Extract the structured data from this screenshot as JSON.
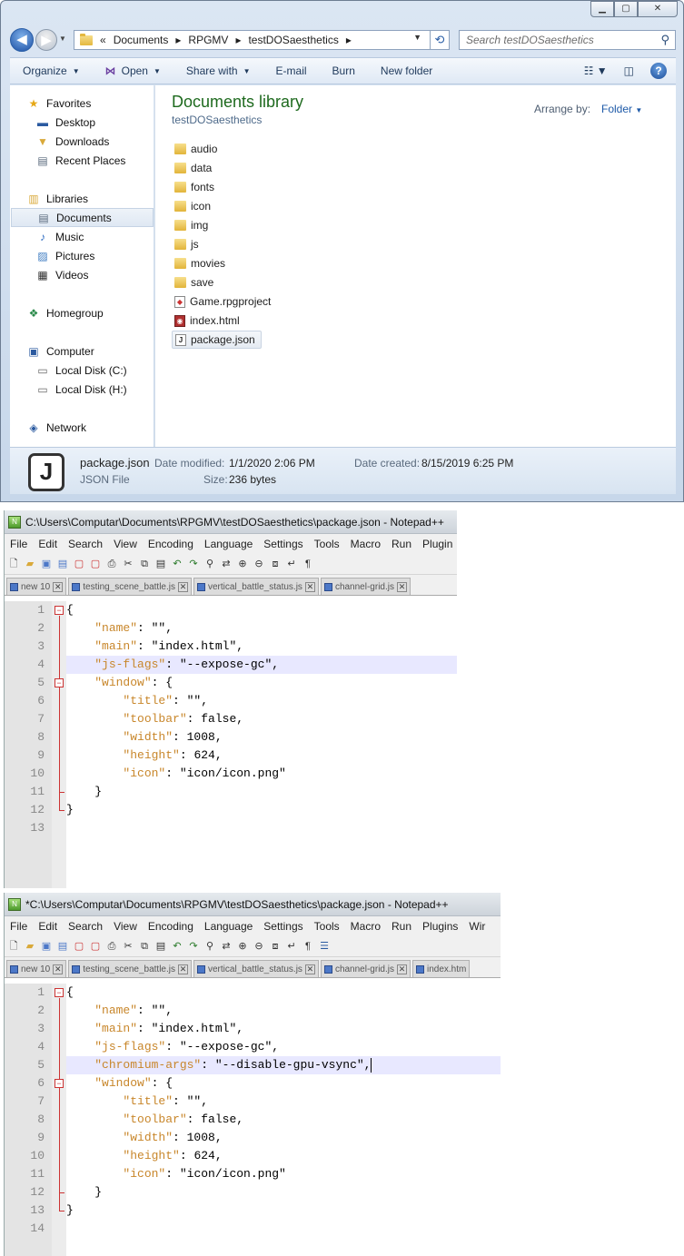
{
  "explorer": {
    "window_controls": {
      "minimize": "▁",
      "maximize": "▢",
      "close": "✕"
    },
    "breadcrumb": {
      "prefix": "«",
      "items": [
        "Documents",
        "RPGMV",
        "testDOSaesthetics"
      ],
      "sep": "▸"
    },
    "search_placeholder": "Search testDOSaesthetics",
    "toolbar": {
      "organize": "Organize",
      "open": "Open",
      "share_with": "Share with",
      "email": "E-mail",
      "burn": "Burn",
      "new_folder": "New folder"
    },
    "sidebar": {
      "favorites": "Favorites",
      "desktop": "Desktop",
      "downloads": "Downloads",
      "recent_places": "Recent Places",
      "libraries": "Libraries",
      "documents": "Documents",
      "music": "Music",
      "pictures": "Pictures",
      "videos": "Videos",
      "homegroup": "Homegroup",
      "computer": "Computer",
      "local_disk_c": "Local Disk (C:)",
      "local_disk_h": "Local Disk (H:)",
      "network": "Network"
    },
    "library_title": "Documents library",
    "library_subtitle": "testDOSaesthetics",
    "arrange_by_label": "Arrange by:",
    "arrange_by_value": "Folder",
    "files": [
      {
        "name": "audio",
        "type": "folder"
      },
      {
        "name": "data",
        "type": "folder"
      },
      {
        "name": "fonts",
        "type": "folder"
      },
      {
        "name": "icon",
        "type": "folder"
      },
      {
        "name": "img",
        "type": "folder"
      },
      {
        "name": "js",
        "type": "folder"
      },
      {
        "name": "movies",
        "type": "folder"
      },
      {
        "name": "save",
        "type": "folder"
      },
      {
        "name": "Game.rpgproject",
        "type": "file"
      },
      {
        "name": "index.html",
        "type": "file"
      },
      {
        "name": "package.json",
        "type": "file",
        "selected": true
      }
    ],
    "details": {
      "name": "package.json",
      "type": "JSON File",
      "modified_label": "Date modified:",
      "modified_value": "1/1/2020 2:06 PM",
      "size_label": "Size:",
      "size_value": "236 bytes",
      "created_label": "Date created:",
      "created_value": "8/15/2019 6:25 PM"
    }
  },
  "npp1": {
    "title": "C:\\Users\\Computar\\Documents\\RPGMV\\testDOSaesthetics\\package.json - Notepad++",
    "menu": [
      "File",
      "Edit",
      "Search",
      "View",
      "Encoding",
      "Language",
      "Settings",
      "Tools",
      "Macro",
      "Run",
      "Plugin"
    ],
    "tabs": [
      "new 10",
      "testing_scene_battle.js",
      "vertical_battle_status.js",
      "channel-grid.js"
    ],
    "line_numbers": [
      "1",
      "2",
      "3",
      "4",
      "5",
      "6",
      "7",
      "8",
      "9",
      "10",
      "11",
      "12",
      "13"
    ]
  },
  "npp2": {
    "title": "*C:\\Users\\Computar\\Documents\\RPGMV\\testDOSaesthetics\\package.json - Notepad++",
    "menu": [
      "File",
      "Edit",
      "Search",
      "View",
      "Encoding",
      "Language",
      "Settings",
      "Tools",
      "Macro",
      "Run",
      "Plugins",
      "Wir"
    ],
    "tabs": [
      "new 10",
      "testing_scene_battle.js",
      "vertical_battle_status.js",
      "channel-grid.js",
      "index.htm"
    ],
    "line_numbers": [
      "1",
      "2",
      "3",
      "4",
      "5",
      "6",
      "7",
      "8",
      "9",
      "10",
      "11",
      "12",
      "13",
      "14"
    ]
  },
  "code": {
    "open_brace": "{",
    "close_brace": "}",
    "name_key": "\"name\"",
    "name_val": ": \"\",",
    "main_key": "\"main\"",
    "main_val": ": \"index.html\",",
    "jsflags_key": "\"js-flags\"",
    "jsflags_val": ": \"--expose-gc\",",
    "chromium_key": "\"chromium-args\"",
    "chromium_val": ": \"--disable-gpu-vsync\",",
    "window_key": "\"window\"",
    "window_val": ": {",
    "title_key": "\"title\"",
    "title_val": ": \"\",",
    "toolbar_key": "\"toolbar\"",
    "toolbar_val": ": false,",
    "width_key": "\"width\"",
    "width_val": ": 1008,",
    "height_key": "\"height\"",
    "height_val": ": 624,",
    "icon_key": "\"icon\"",
    "icon_val": ": \"icon/icon.png\"",
    "inner_close": "}"
  }
}
